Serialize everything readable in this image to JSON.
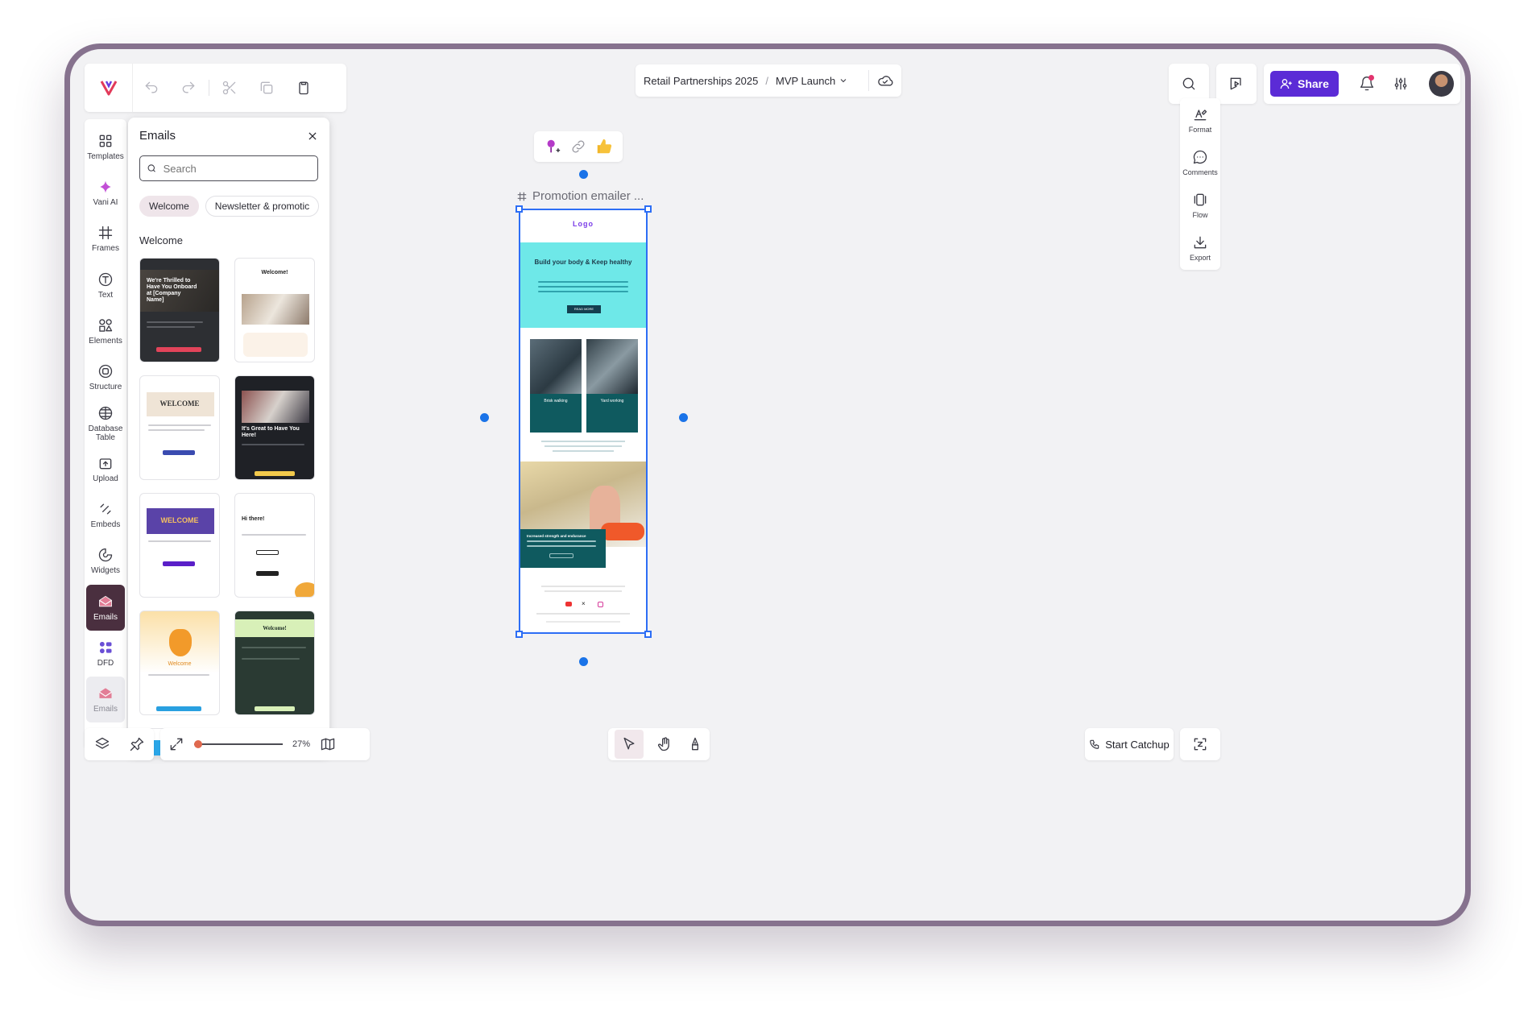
{
  "breadcrumb": {
    "project": "Retail Partnerships 2025",
    "separator": "/",
    "page": "MVP Launch"
  },
  "top_right": {
    "share_label": "Share"
  },
  "left_rail": [
    {
      "label": "Templates",
      "icon": "grid-icon"
    },
    {
      "label": "Vani AI",
      "icon": "sparkle-icon"
    },
    {
      "label": "Frames",
      "icon": "frame-icon"
    },
    {
      "label": "Text",
      "icon": "text-icon"
    },
    {
      "label": "Elements",
      "icon": "shapes-icon"
    },
    {
      "label": "Structure",
      "icon": "structure-icon"
    },
    {
      "label": "Database Table",
      "icon": "table-icon"
    },
    {
      "label": "Upload",
      "icon": "upload-icon"
    },
    {
      "label": "Embeds",
      "icon": "embed-icon"
    },
    {
      "label": "Widgets",
      "icon": "widget-icon"
    },
    {
      "label": "Emails",
      "icon": "email-icon",
      "active": true
    },
    {
      "label": "DFD",
      "icon": "dfd-icon"
    },
    {
      "label": "Emails",
      "icon": "email-icon"
    }
  ],
  "panel": {
    "title": "Emails",
    "search_placeholder": "Search",
    "chips": [
      "Welcome",
      "Newsletter & promotic"
    ],
    "section_title": "Welcome",
    "thumbs": [
      {
        "text": "We're Thrilled to Have You Onboard at [Company Name]"
      },
      {
        "text": "Welcome!"
      },
      {
        "text": "WELCOME"
      },
      {
        "text": "It's Great to Have You Here!"
      },
      {
        "text": "WELCOME"
      },
      {
        "text": "Hi there!"
      },
      {
        "text": "Welcome"
      },
      {
        "text": "Welcome!"
      }
    ]
  },
  "canvas": {
    "frame_label": "Promotion emailer ...",
    "email": {
      "logo": "Logo",
      "hero_title": "Build your body & Keep healthy",
      "hero_button": "READ MORE",
      "tile_1": "Brisk walking",
      "tile_2": "Yard working",
      "overlay_title": "Increased strength and endurance"
    }
  },
  "bottom": {
    "zoom": "27%",
    "catchup_label": "Start Catchup"
  },
  "right_rail": [
    {
      "label": "Format",
      "icon": "format-icon"
    },
    {
      "label": "Comments",
      "icon": "comment-icon"
    },
    {
      "label": "Flow",
      "icon": "flow-icon"
    },
    {
      "label": "Export",
      "icon": "export-icon"
    }
  ],
  "colors": {
    "accent": "#5b2bd6",
    "selection": "#2d6ef5",
    "active_rail": "#4a2f3f"
  }
}
